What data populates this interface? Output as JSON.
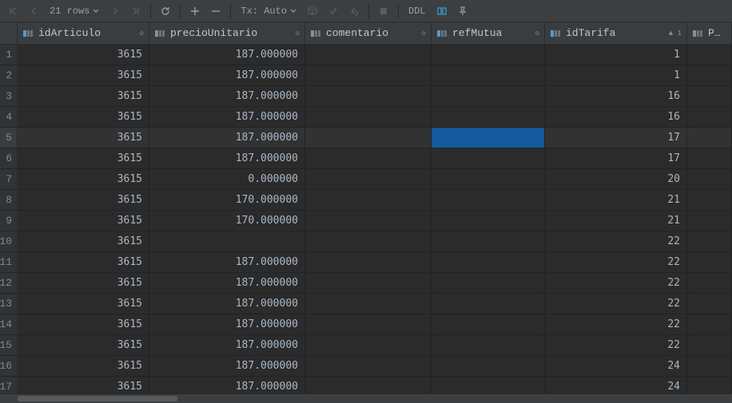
{
  "toolbar": {
    "rows_label": "21 rows",
    "tx_label": "Tx: Auto",
    "ddl_label": "DDL"
  },
  "columns": [
    {
      "name": "idArticulo",
      "iconColor": "#4e9cd6",
      "sort": "◇"
    },
    {
      "name": "precioUnitario",
      "iconColor": "#8a9095",
      "sort": "◇"
    },
    {
      "name": "comentario",
      "iconColor": "#8a9095",
      "sort": "◇"
    },
    {
      "name": "refMutua",
      "iconColor": "#4e9cd6",
      "sort": "◇"
    },
    {
      "name": "idTarifa",
      "iconColor": "#4e9cd6",
      "sort": "▲ 1"
    },
    {
      "name": "Pedi",
      "iconColor": "#8a9095",
      "sort": ""
    }
  ],
  "rows": [
    {
      "n": "1",
      "idArticulo": "3615",
      "precioUnitario": "187.000000",
      "comentario": "",
      "refMutua": "",
      "idTarifa": "1"
    },
    {
      "n": "2",
      "idArticulo": "3615",
      "precioUnitario": "187.000000",
      "comentario": "",
      "refMutua": "",
      "idTarifa": "1"
    },
    {
      "n": "3",
      "idArticulo": "3615",
      "precioUnitario": "187.000000",
      "comentario": "",
      "refMutua": "",
      "idTarifa": "16"
    },
    {
      "n": "4",
      "idArticulo": "3615",
      "precioUnitario": "187.000000",
      "comentario": "",
      "refMutua": "",
      "idTarifa": "16"
    },
    {
      "n": "5",
      "idArticulo": "3615",
      "precioUnitario": "187.000000",
      "comentario": "",
      "refMutua": "",
      "idTarifa": "17",
      "highlight": true,
      "selectedCol": "refMutua"
    },
    {
      "n": "6",
      "idArticulo": "3615",
      "precioUnitario": "187.000000",
      "comentario": "",
      "refMutua": "",
      "idTarifa": "17"
    },
    {
      "n": "7",
      "idArticulo": "3615",
      "precioUnitario": "0.000000",
      "comentario": "",
      "refMutua": "",
      "idTarifa": "20"
    },
    {
      "n": "8",
      "idArticulo": "3615",
      "precioUnitario": "170.000000",
      "comentario": "",
      "refMutua": "",
      "idTarifa": "21"
    },
    {
      "n": "9",
      "idArticulo": "3615",
      "precioUnitario": "170.000000",
      "comentario": "",
      "refMutua": "",
      "idTarifa": "21"
    },
    {
      "n": "10",
      "idArticulo": "3615",
      "precioUnitario": null,
      "comentario": "",
      "refMutua": "",
      "idTarifa": "22"
    },
    {
      "n": "11",
      "idArticulo": "3615",
      "precioUnitario": "187.000000",
      "comentario": "",
      "refMutua": "",
      "idTarifa": "22"
    },
    {
      "n": "12",
      "idArticulo": "3615",
      "precioUnitario": "187.000000",
      "comentario": "",
      "refMutua": "",
      "idTarifa": "22"
    },
    {
      "n": "13",
      "idArticulo": "3615",
      "precioUnitario": "187.000000",
      "comentario": "",
      "refMutua": "",
      "idTarifa": "22"
    },
    {
      "n": "14",
      "idArticulo": "3615",
      "precioUnitario": "187.000000",
      "comentario": "",
      "refMutua": "",
      "idTarifa": "22"
    },
    {
      "n": "15",
      "idArticulo": "3615",
      "precioUnitario": "187.000000",
      "comentario": "",
      "refMutua": "",
      "idTarifa": "22"
    },
    {
      "n": "16",
      "idArticulo": "3615",
      "precioUnitario": "187.000000",
      "comentario": "",
      "refMutua": "",
      "idTarifa": "24"
    },
    {
      "n": "17",
      "idArticulo": "3615",
      "precioUnitario": "187.000000",
      "comentario": "",
      "refMutua": "",
      "idTarifa": "24"
    }
  ],
  "null_token": "<null>"
}
